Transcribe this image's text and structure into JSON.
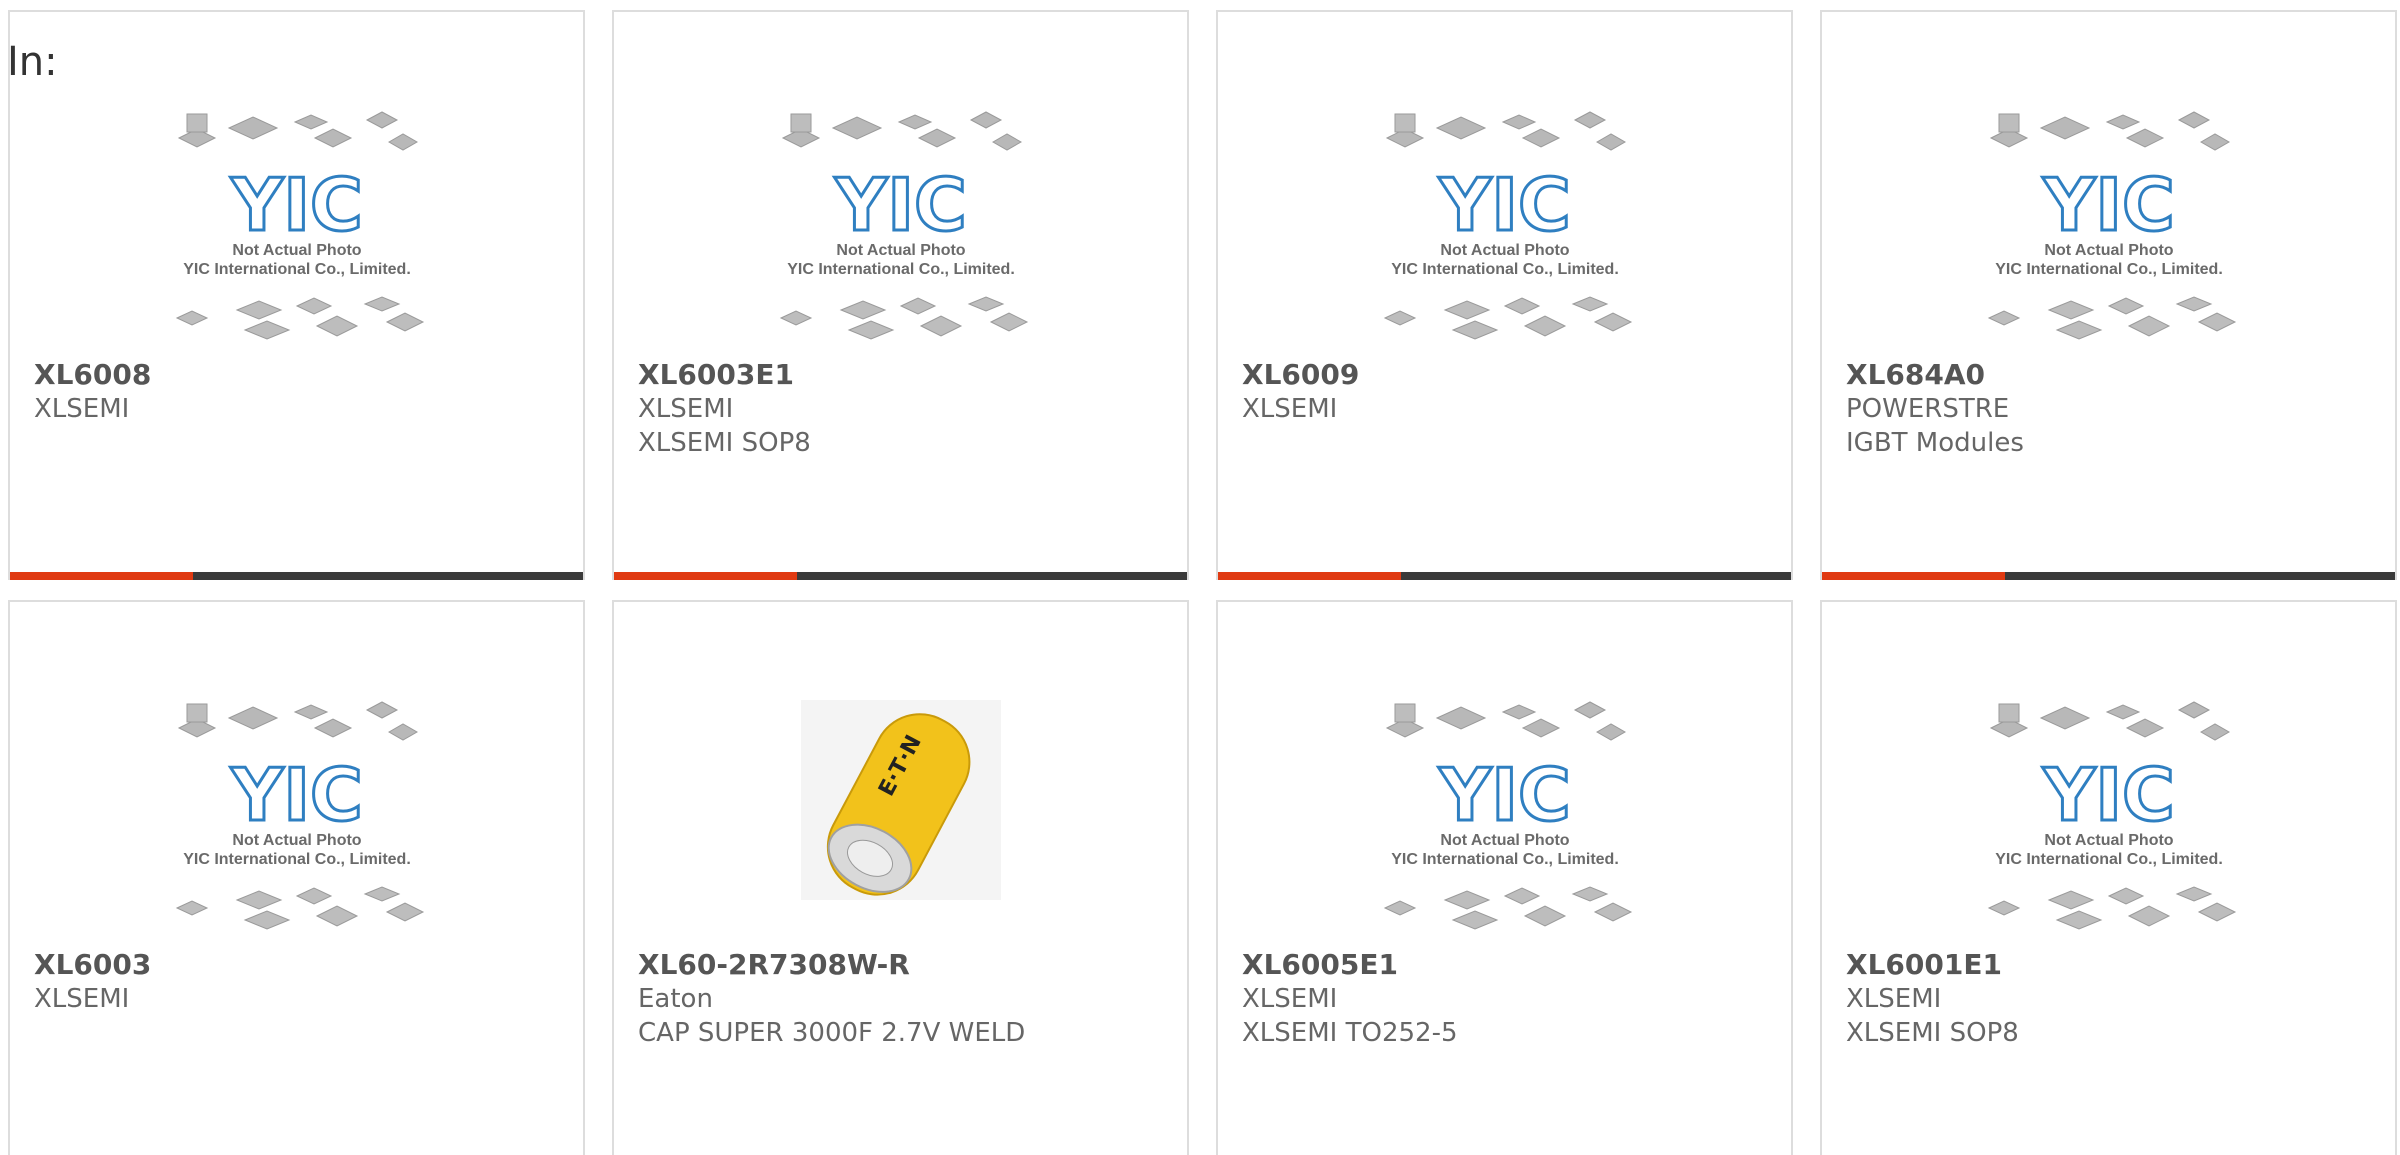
{
  "header": {
    "label": "In:"
  },
  "colors": {
    "accent": "#e03a12",
    "bar": "#3a3a3a",
    "border": "#dddddd"
  },
  "placeholder": {
    "logo_text": "YIC",
    "line1": "Not Actual Photo",
    "line2": "YIC International Co., Limited."
  },
  "products": [
    {
      "part": "XL6008",
      "maker": "XLSEMI",
      "desc": "",
      "image": "yic-placeholder-icon"
    },
    {
      "part": "XL6003E1",
      "maker": "XLSEMI",
      "desc": "XLSEMI SOP8",
      "image": "yic-placeholder-icon"
    },
    {
      "part": "XL6009",
      "maker": "XLSEMI",
      "desc": "",
      "image": "yic-placeholder-icon"
    },
    {
      "part": "XL684A0",
      "maker": "POWERSTRE",
      "desc": "IGBT Modules",
      "image": "yic-placeholder-icon"
    },
    {
      "part": "XL6003",
      "maker": "XLSEMI",
      "desc": "",
      "image": "yic-placeholder-icon"
    },
    {
      "part": "XL60-2R7308W-R",
      "maker": "Eaton",
      "desc": "CAP SUPER 3000F 2.7V WELD",
      "image": "supercapacitor-photo",
      "cap_label": "E·T·N"
    },
    {
      "part": "XL6005E1",
      "maker": "XLSEMI",
      "desc": "XLSEMI TO252-5",
      "image": "yic-placeholder-icon"
    },
    {
      "part": "XL6001E1",
      "maker": "XLSEMI",
      "desc": "XLSEMI SOP8",
      "image": "yic-placeholder-icon"
    }
  ]
}
